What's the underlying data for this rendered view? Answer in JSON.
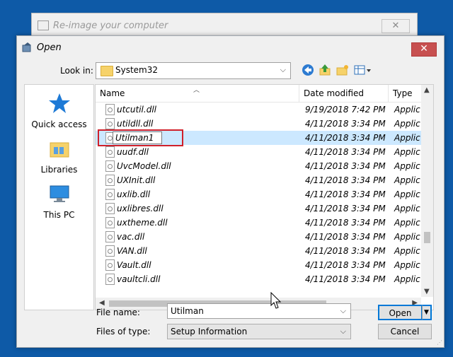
{
  "background_window": {
    "title": "Re-image your computer",
    "close_glyph": "✕"
  },
  "dialog": {
    "title": "Open",
    "close_glyph": "✕",
    "look_in": {
      "label": "Look in:",
      "value": "System32"
    },
    "places": [
      {
        "label": "Quick access",
        "icon": "quick-access-star-icon"
      },
      {
        "label": "Libraries",
        "icon": "libraries-folder-icon"
      },
      {
        "label": "This PC",
        "icon": "this-pc-icon"
      }
    ],
    "columns": [
      {
        "label": "Name"
      },
      {
        "label": "Date modified"
      },
      {
        "label": "Type"
      }
    ],
    "files": [
      {
        "name": "utcutil.dll",
        "date": "9/19/2018 7:42 PM",
        "type": "Applic"
      },
      {
        "name": "utildll.dll",
        "date": "4/11/2018 3:34 PM",
        "type": "Applic"
      },
      {
        "name": "Utilman1",
        "date": "4/11/2018 3:34 PM",
        "type": "Applic",
        "selected": true,
        "renaming": true
      },
      {
        "name": "uudf.dll",
        "date": "4/11/2018 3:34 PM",
        "type": "Applic"
      },
      {
        "name": "UvcModel.dll",
        "date": "4/11/2018 3:34 PM",
        "type": "Applic"
      },
      {
        "name": "UXInit.dll",
        "date": "4/11/2018 3:34 PM",
        "type": "Applic"
      },
      {
        "name": "uxlib.dll",
        "date": "4/11/2018 3:34 PM",
        "type": "Applic"
      },
      {
        "name": "uxlibres.dll",
        "date": "4/11/2018 3:34 PM",
        "type": "Applic"
      },
      {
        "name": "uxtheme.dll",
        "date": "4/11/2018 3:34 PM",
        "type": "Applic"
      },
      {
        "name": "vac.dll",
        "date": "4/11/2018 3:34 PM",
        "type": "Applic"
      },
      {
        "name": "VAN.dll",
        "date": "4/11/2018 3:34 PM",
        "type": "Applic"
      },
      {
        "name": "Vault.dll",
        "date": "4/11/2018 3:34 PM",
        "type": "Applic"
      },
      {
        "name": "vaultcli.dll",
        "date": "4/11/2018 3:34 PM",
        "type": "Applic"
      }
    ],
    "file_name": {
      "label": "File name:",
      "value": "Utilman"
    },
    "files_of_type": {
      "label": "Files of type:",
      "value": "Setup Information"
    },
    "buttons": {
      "open": "Open",
      "cancel": "Cancel"
    }
  },
  "colors": {
    "desktop": "#0e5aa7",
    "selection": "#cce8ff",
    "highlight_box": "#d0202a",
    "accent": "#0078d7"
  }
}
